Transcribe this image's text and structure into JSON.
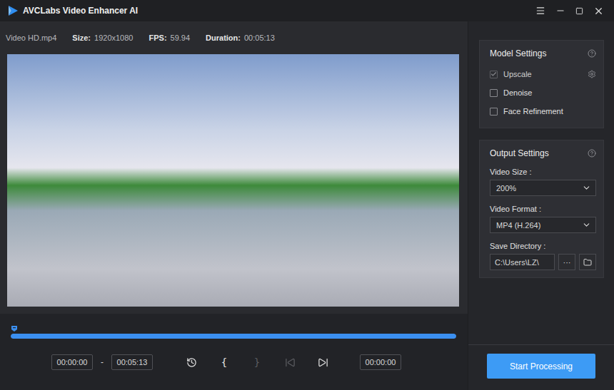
{
  "window": {
    "title": "AVCLabs Video Enhancer AI"
  },
  "file": {
    "name": "Video HD.mp4",
    "info": [
      {
        "label": "Size:",
        "value": "1920x1080"
      },
      {
        "label": "FPS:",
        "value": "59.94"
      },
      {
        "label": "Duration:",
        "value": "00:05:13"
      }
    ]
  },
  "timeline": {
    "level": 1,
    "start": "00:00:00",
    "separator": "-",
    "end": "00:05:13",
    "current": "00:00:00"
  },
  "controls": [
    {
      "kind": "icon",
      "icon": "reset",
      "disabled": false
    },
    {
      "kind": "glyph",
      "label": "{",
      "disabled": false
    },
    {
      "kind": "glyph",
      "label": "}",
      "disabled": true
    },
    {
      "kind": "icon",
      "icon": "prev",
      "disabled": true
    },
    {
      "kind": "icon",
      "icon": "next",
      "disabled": false
    }
  ],
  "model_settings": {
    "title": "Model Settings",
    "options": [
      {
        "label": "Upscale",
        "checked": true,
        "disabled": true,
        "has_settings": true
      },
      {
        "label": "Denoise",
        "checked": false,
        "disabled": false,
        "has_settings": false
      },
      {
        "label": "Face Refinement",
        "checked": false,
        "disabled": false,
        "has_settings": false
      }
    ]
  },
  "output_settings": {
    "title": "Output Settings",
    "fields": [
      {
        "kind": "select",
        "label": "Video Size :",
        "value": "200%"
      },
      {
        "kind": "select",
        "label": "Video Format :",
        "value": "MP4 (H.264)"
      },
      {
        "kind": "path",
        "label": "Save Directory :",
        "value": "C:\\Users\\LZ\\",
        "button": "···"
      }
    ]
  },
  "start_button": "Start Processing"
}
